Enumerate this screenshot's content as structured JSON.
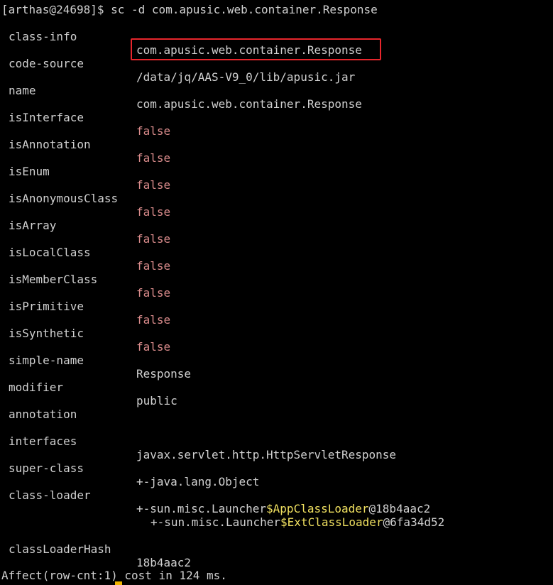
{
  "prompt": "[arthas@24698]$ sc -d com.apusic.web.container.Response",
  "rows": [
    {
      "key": "class-info",
      "value": "com.apusic.web.container.Response"
    },
    {
      "key": "code-source",
      "value": "/data/jq/AAS-V9_0/lib/apusic.jar"
    },
    {
      "key": "name",
      "value": "com.apusic.web.container.Response"
    },
    {
      "key": "isInterface",
      "value": "false"
    },
    {
      "key": "isAnnotation",
      "value": "false"
    },
    {
      "key": "isEnum",
      "value": "false"
    },
    {
      "key": "isAnonymousClass",
      "value": "false"
    },
    {
      "key": "isArray",
      "value": "false"
    },
    {
      "key": "isLocalClass",
      "value": "false"
    },
    {
      "key": "isMemberClass",
      "value": "false"
    },
    {
      "key": "isPrimitive",
      "value": "false"
    },
    {
      "key": "isSynthetic",
      "value": "false"
    },
    {
      "key": "simple-name",
      "value": "Response"
    },
    {
      "key": "modifier",
      "value": "public"
    },
    {
      "key": "annotation",
      "value": ""
    },
    {
      "key": "interfaces",
      "value": "javax.servlet.http.HttpServletResponse"
    },
    {
      "key": "super-class",
      "value": "+-java.lang.Object"
    },
    {
      "key": "class-loader",
      "value_prefix": "+-sun.misc.Launcher",
      "value_highlight": "$AppClassLoader",
      "value_suffix": "@18b4aac2"
    },
    {
      "key": "",
      "value_prefix": "+-sun.misc.Launcher",
      "value_highlight": "$ExtClassLoader",
      "value_suffix": "@6fa34d52"
    },
    {
      "key": "classLoaderHash",
      "value": "18b4aac2"
    }
  ],
  "footer": "Affect(row-cnt:1) cost in 124 ms.",
  "colors": {
    "background": "#000000",
    "text": "#d0d0d0",
    "false_value": "#d98b8b",
    "highlight": "#f0e060",
    "annotation_box": "#e8262c",
    "cursor": "#f0b400"
  }
}
